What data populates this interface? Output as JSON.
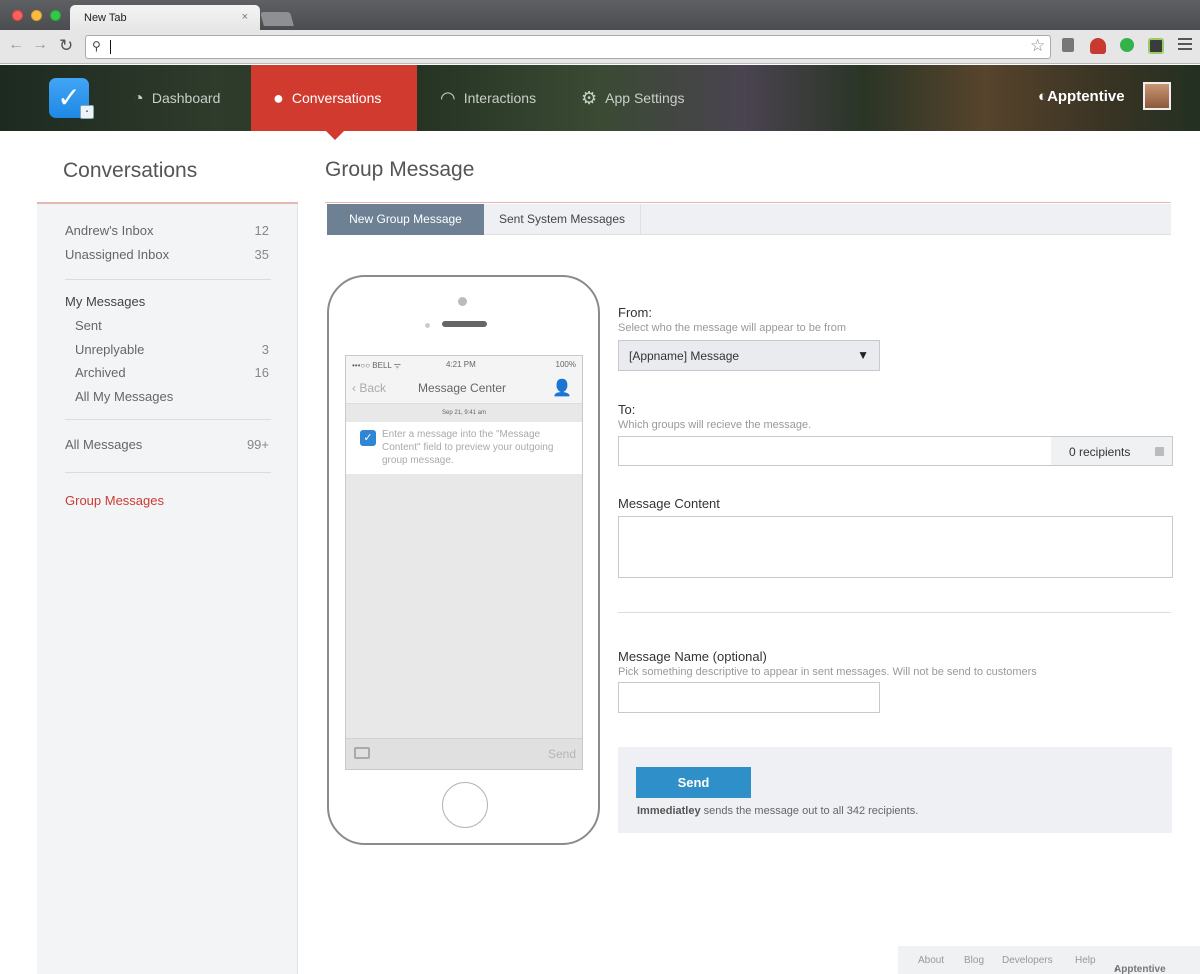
{
  "browser": {
    "tab_title": "New Tab",
    "tab_close": "×",
    "address_value": ""
  },
  "app": {
    "nav": [
      {
        "label": "Dashboard",
        "icon": "dashboard-icon"
      },
      {
        "label": "Conversations",
        "icon": "chat-bubble-icon"
      },
      {
        "label": "Interactions",
        "icon": "interactions-icon"
      },
      {
        "label": "App Settings",
        "icon": "gear-icon"
      }
    ],
    "active_nav": "Conversations",
    "brand": "Apptentive",
    "accent_color": "#d13a2f"
  },
  "sidebar": {
    "title": "Conversations",
    "inboxes": [
      {
        "label": "Andrew's Inbox",
        "count": "12"
      },
      {
        "label": "Unassigned Inbox",
        "count": "35"
      }
    ],
    "my_messages_heading": "My Messages",
    "my_messages": [
      {
        "label": "Sent",
        "count": ""
      },
      {
        "label": "Unreplyable",
        "count": "3"
      },
      {
        "label": "Archived",
        "count": "16"
      },
      {
        "label": "All My Messages",
        "count": ""
      }
    ],
    "all_messages": {
      "label": "All Messages",
      "count": "99+"
    },
    "group_messages": "Group Messages"
  },
  "main": {
    "title": "Group Message",
    "tabs": [
      {
        "label": "New Group Message",
        "active": true
      },
      {
        "label": "Sent System Messages",
        "active": false
      }
    ]
  },
  "phone": {
    "status_left": "•••○○ BELL ᯤ",
    "status_time": "4:21 PM",
    "status_right": "100%",
    "back": "Back",
    "title": "Message Center",
    "date": "Sep 21, 9:41 am",
    "preview_text": "Enter a message into the \"Message Content\" field to preview your outgoing group message.",
    "send": "Send"
  },
  "form": {
    "from_label": "From:",
    "from_hint": "Select who the message will appear to be from",
    "from_value": "[Appname] Message",
    "to_label": "To:",
    "to_hint": "Which groups will recieve the message.",
    "to_value": "",
    "recipients": "0 recipients",
    "content_label": "Message Content",
    "content_value": "",
    "name_label": "Message Name (optional)",
    "name_hint": "Pick something descriptive to appear in sent messages.  Will not be send to customers",
    "name_value": "",
    "send_button": "Send",
    "send_note_bold": "Immediatley",
    "send_note_rest": " sends the message out to all 342 recipients."
  },
  "footer": {
    "links": [
      "About",
      "Blog",
      "Developers",
      "Help"
    ],
    "brand": "Apptentive"
  }
}
